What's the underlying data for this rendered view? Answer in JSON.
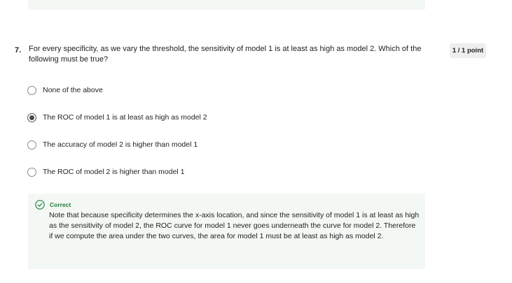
{
  "question": {
    "number": "7.",
    "text": "For every specificity, as we vary the threshold, the sensitivity of model 1 is at least as high as model 2. Which of the following must be true?",
    "points": "1 / 1 point"
  },
  "options": [
    {
      "label": "None of the above",
      "selected": false
    },
    {
      "label": "The ROC of model 1 is at least as high as model 2",
      "selected": true
    },
    {
      "label": "The accuracy of model 2 is higher than model 1",
      "selected": false
    },
    {
      "label": "The ROC of model 2 is higher than model 1",
      "selected": false
    }
  ],
  "feedback": {
    "status": "Correct",
    "status_color": "#1e7a3a",
    "icon": "check-circle-icon",
    "text": "Note that because specificity determines the x-axis location, and since the sensitivity of model 1 is at least as high as the sensitivity of model 2, the ROC curve for model 1 never goes underneath the curve for model 2. Therefore if we compute the area under the two curves, the area for model 1 must be at least as high as model 2."
  },
  "colors": {
    "feedback_background": "#f3f8f4",
    "badge_background": "#eeeeee"
  }
}
